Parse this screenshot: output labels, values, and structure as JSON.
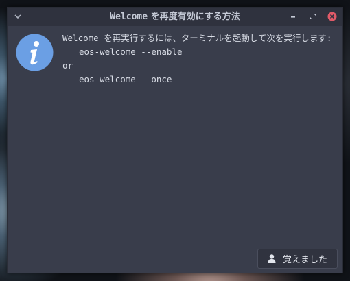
{
  "window": {
    "title_prefix": "Welcome",
    "title_suffix": " を再度有効にする方法"
  },
  "message": {
    "line1": "Welcome を再実行するには、ターミナルを起動して次を実行します:",
    "cmd1": "eos-welcome --enable",
    "or": "or",
    "cmd2": "eos-welcome --once"
  },
  "button": {
    "label": "覚えました",
    "icon": "user-icon"
  },
  "colors": {
    "window_bg": "#393d4b",
    "titlebar_bg": "#2f323e",
    "close_red": "#e05a68",
    "info_blue": "#6b9fe4"
  }
}
